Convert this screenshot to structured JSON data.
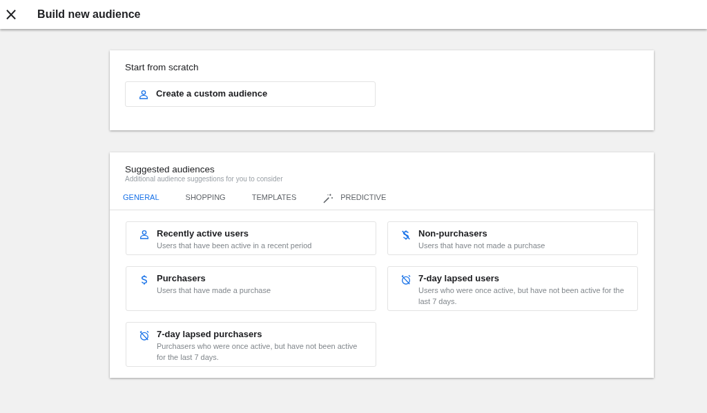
{
  "header": {
    "close_icon": "×",
    "title": "Build new audience"
  },
  "scratch": {
    "title": "Start from scratch",
    "option": {
      "kind": "person",
      "title": "Create a custom audience"
    }
  },
  "suggested": {
    "title": "Suggested audiences",
    "subtitle": "Additional audience suggestions for you to consider",
    "tabs": [
      {
        "label": "GENERAL",
        "selected": true,
        "kind": "plain"
      },
      {
        "label": "SHOPPING",
        "selected": false,
        "kind": "plain"
      },
      {
        "label": "TEMPLATES",
        "selected": false,
        "kind": "plain"
      },
      {
        "label": "PREDICTIVE",
        "selected": false,
        "kind": "predictive"
      }
    ],
    "items": [
      {
        "kind": "person",
        "title": "Recently active users",
        "description": "Users that have been active in a recent period"
      },
      {
        "kind": "non-purchaser",
        "title": "Non-purchasers",
        "description": "Users that have not made a purchase"
      },
      {
        "kind": "purchaser",
        "title": "Purchasers",
        "description": "Users that have made a purchase"
      },
      {
        "kind": "lapsed",
        "title": "7-day lapsed users",
        "description": "Users who were once active, but have not been active for the last 7 days."
      },
      {
        "kind": "lapsed",
        "title": "7-day lapsed purchasers",
        "description": "Purchasers who were once active, but have not been active for the last 7 days."
      }
    ]
  }
}
